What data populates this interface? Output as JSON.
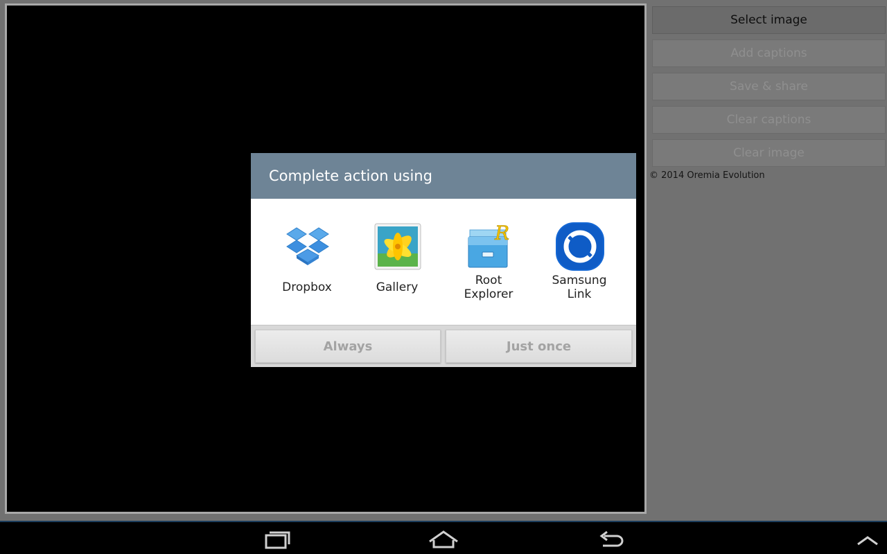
{
  "right_panel": {
    "select_image": "Select image",
    "add_captions": "Add captions",
    "save_share": "Save & share",
    "clear_captions": "Clear captions",
    "clear_image": "Clear image",
    "copyright": "© 2014 Oremia Evolution"
  },
  "dialog": {
    "title": "Complete action using",
    "apps": [
      {
        "label": "Dropbox",
        "icon": "dropbox-icon"
      },
      {
        "label": "Gallery",
        "icon": "gallery-icon"
      },
      {
        "label_line1": "Root",
        "label_line2": "Explorer",
        "icon": "root-explorer-icon"
      },
      {
        "label_line1": "Samsung",
        "label_line2": "Link",
        "icon": "samsung-link-icon"
      }
    ],
    "always_label": "Always",
    "just_once_label": "Just once"
  },
  "nav": {
    "icons": [
      "recent-apps-icon",
      "home-icon",
      "back-icon",
      "chevron-up-icon"
    ]
  },
  "colors": {
    "dialog_header": "#6e8496",
    "nav_bar": "#000000"
  }
}
